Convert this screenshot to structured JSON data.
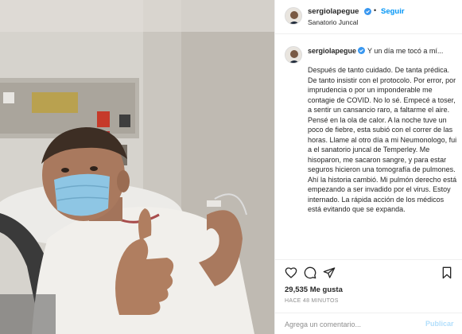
{
  "post": {
    "username": "sergiolapegue",
    "follow_label": "Seguir",
    "separator": "•",
    "location": "Sanatorio Juncal",
    "more_label": "···",
    "caption_title": "Y un día me tocó a mí...",
    "caption_text": "Después de tanto cuidado. De tanta prédica. De tanto insistir con el protocolo. Por error, por imprudencia o por un imponderable me contagie de COVID. No lo sé. Empecé a toser, a sentir un cansancio raro, a faltarme el aire. Pensé en la ola de calor. A la noche tuve un poco de fiebre, esta subió con el correr de las horas. Llame al otro día a mi Neumonologo, fui a el sanatorio juncal de Temperley. Me hisoparon, me sacaron sangre, y para estar seguros hicieron una tomografía de pulmones. Ahí la historia cambió. Mi pulmón derecho está empezando a ser invadido por el virus. Estoy internado. La rápida acción de los médicos está evitando que se expanda.",
    "likes": "29,535 Me gusta",
    "time_ago": "HACE 48 MINUTOS",
    "comment_placeholder": "Agrega un comentario...",
    "publish_label": "Publicar"
  },
  "icons": {
    "verified": "verified-badge-icon",
    "like": "heart-icon",
    "comment": "comment-bubble-icon",
    "share": "paper-plane-icon",
    "save": "bookmark-icon"
  },
  "colors": {
    "accent": "#0095f6",
    "publish_disabled": "#b2dffc",
    "muted": "#8e8e8e",
    "border": "#efefef",
    "mask": "#8ec6e4"
  }
}
